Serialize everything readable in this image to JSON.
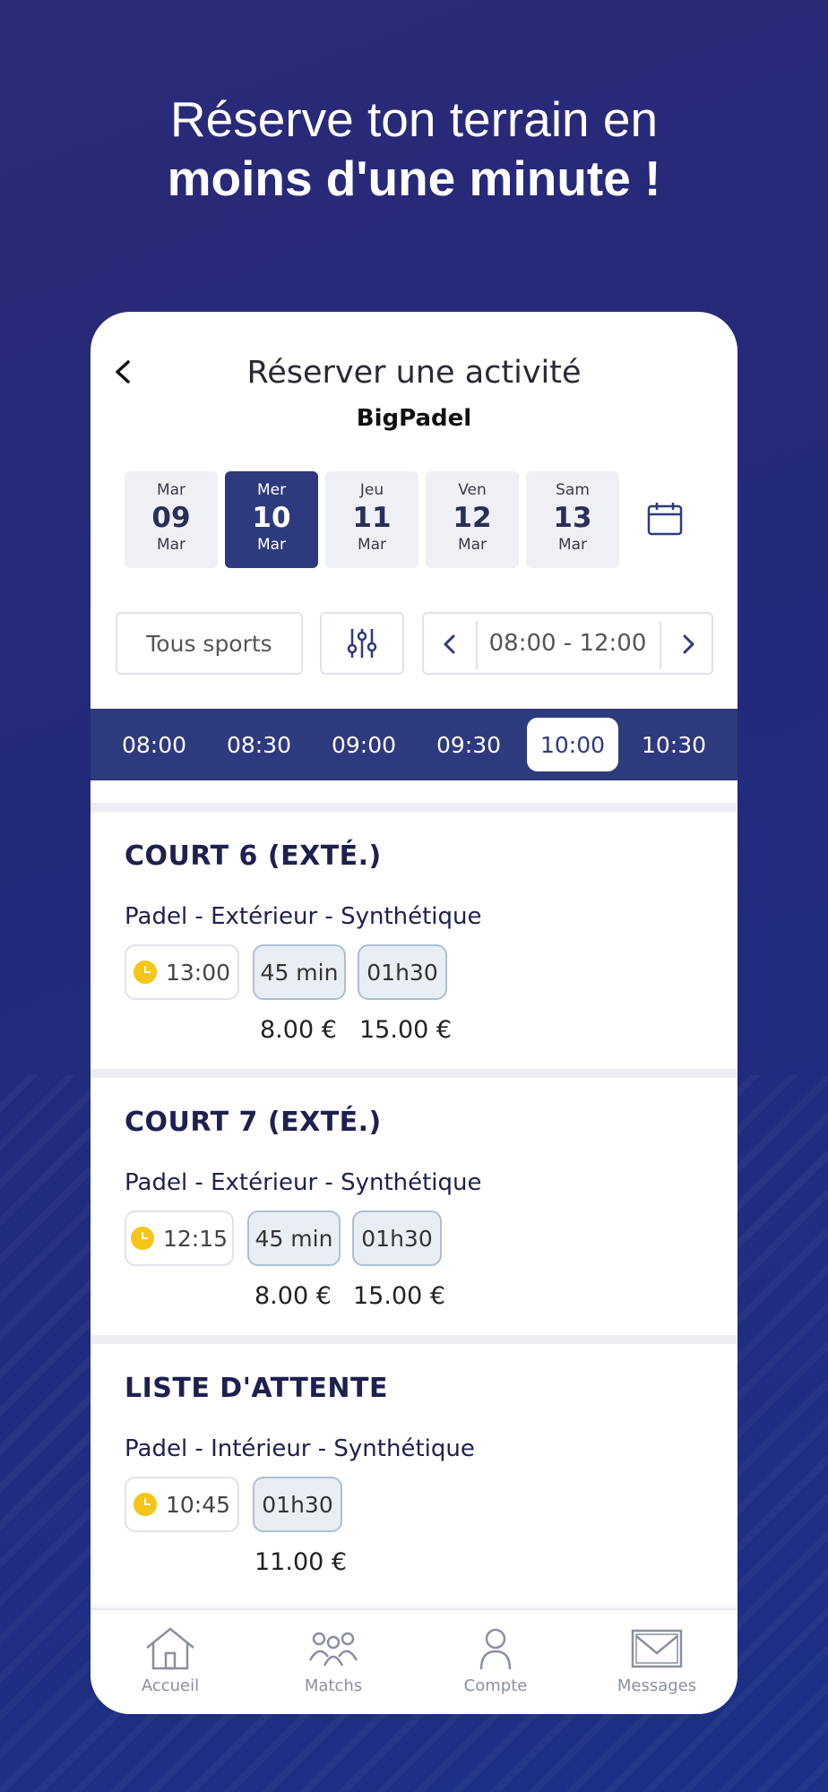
{
  "promo": {
    "line1": "Réserve ton terrain en",
    "line2": "moins d'une minute !"
  },
  "header": {
    "title": "Réserver une activité",
    "subtitle": "BigPadel",
    "back_icon": "chevron-left-icon"
  },
  "days": [
    {
      "name": "Mar",
      "date": "09",
      "month": "Mar",
      "selected": false
    },
    {
      "name": "Mer",
      "date": "10",
      "month": "Mar",
      "selected": true
    },
    {
      "name": "Jeu",
      "date": "11",
      "month": "Mar",
      "selected": false
    },
    {
      "name": "Ven",
      "date": "12",
      "month": "Mar",
      "selected": false
    },
    {
      "name": "Sam",
      "date": "13",
      "month": "Mar",
      "selected": false
    }
  ],
  "filters": {
    "sports_label": "Tous sports",
    "range_label": "08:00 - 12:00"
  },
  "time_slots": [
    "08:00",
    "08:30",
    "09:00",
    "09:30",
    "10:00",
    "10:30"
  ],
  "selected_slot": "10:00",
  "courts": [
    {
      "name": "COURT 6 (EXTÉ.)",
      "description": "Padel - Extérieur  - Synthétique",
      "start": "13:00",
      "durations": [
        "45 min",
        "01h30"
      ],
      "prices": [
        "8.00 €",
        "15.00 €"
      ]
    },
    {
      "name": "COURT 7 (EXTÉ.)",
      "description": "Padel - Extérieur  - Synthétique",
      "start": "12:15",
      "durations": [
        "45 min",
        "01h30"
      ],
      "prices": [
        "8.00 €",
        "15.00 €"
      ]
    },
    {
      "name": "LISTE D'ATTENTE",
      "description": "Padel - Intérieur  - Synthétique",
      "start": "10:45",
      "durations": [
        "01h30"
      ],
      "prices": [
        "11.00 €"
      ]
    }
  ],
  "tabs": [
    {
      "label": "Accueil",
      "icon": "home-icon"
    },
    {
      "label": "Matchs",
      "icon": "group-icon"
    },
    {
      "label": "Compte",
      "icon": "user-icon"
    },
    {
      "label": "Messages",
      "icon": "mail-icon"
    }
  ],
  "colors": {
    "primary": "#2e3a7e",
    "accent_clock": "#f5c518",
    "background": "#242a7a"
  }
}
